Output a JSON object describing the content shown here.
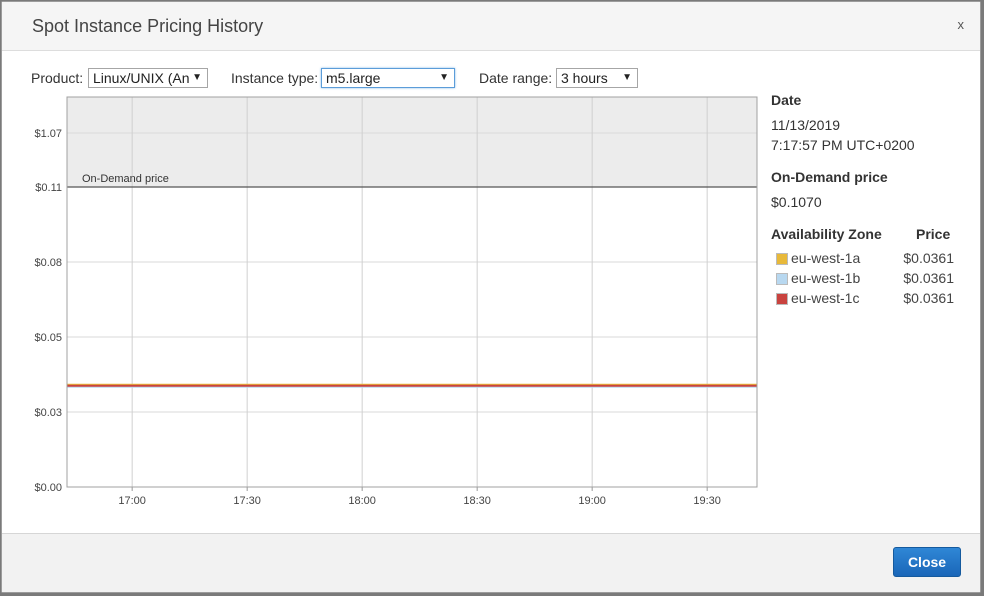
{
  "dialog": {
    "title": "Spot Instance Pricing History",
    "close_x": "x"
  },
  "controls": {
    "product_label": "Product:",
    "product_value": "Linux/UNIX (An",
    "instance_type_label": "Instance type:",
    "instance_type_value": "m5.large",
    "date_range_label": "Date range:",
    "date_range_value": "3 hours"
  },
  "info": {
    "date_header": "Date",
    "date_value": "11/13/2019",
    "time_value": "7:17:57 PM UTC+0200",
    "on_demand_header": "On-Demand price",
    "on_demand_value": "$0.1070",
    "az_header": "Availability Zone",
    "price_header": "Price",
    "zones": [
      {
        "name": "eu-west-1a",
        "price": "$0.0361",
        "color": "#e8b93a"
      },
      {
        "name": "eu-west-1b",
        "price": "$0.0361",
        "color": "#b8d8f0"
      },
      {
        "name": "eu-west-1c",
        "price": "$0.0361",
        "color": "#c9433f"
      }
    ]
  },
  "footer": {
    "close_label": "Close"
  },
  "chart_data": {
    "type": "line",
    "y_tick_labels": [
      "$0.00",
      "$0.03",
      "$0.05",
      "$0.08",
      "$0.11",
      "$1.07"
    ],
    "x_tick_labels": [
      "17:00",
      "17:30",
      "18:00",
      "18:30",
      "19:00",
      "19:30"
    ],
    "x_range": [
      "16:43",
      "19:43"
    ],
    "on_demand_label": "On-Demand price",
    "on_demand_price": 0.107,
    "grid": true,
    "series": [
      {
        "name": "eu-west-1a",
        "color": "#e8b93a",
        "x": [
          "16:43",
          "19:43"
        ],
        "values": [
          0.0361,
          0.0361
        ]
      },
      {
        "name": "eu-west-1b",
        "color": "#b8d8f0",
        "x": [
          "16:43",
          "19:43"
        ],
        "values": [
          0.0361,
          0.0361
        ]
      },
      {
        "name": "eu-west-1c",
        "color": "#c9433f",
        "x": [
          "16:43",
          "19:43"
        ],
        "values": [
          0.0361,
          0.0361
        ]
      }
    ]
  }
}
